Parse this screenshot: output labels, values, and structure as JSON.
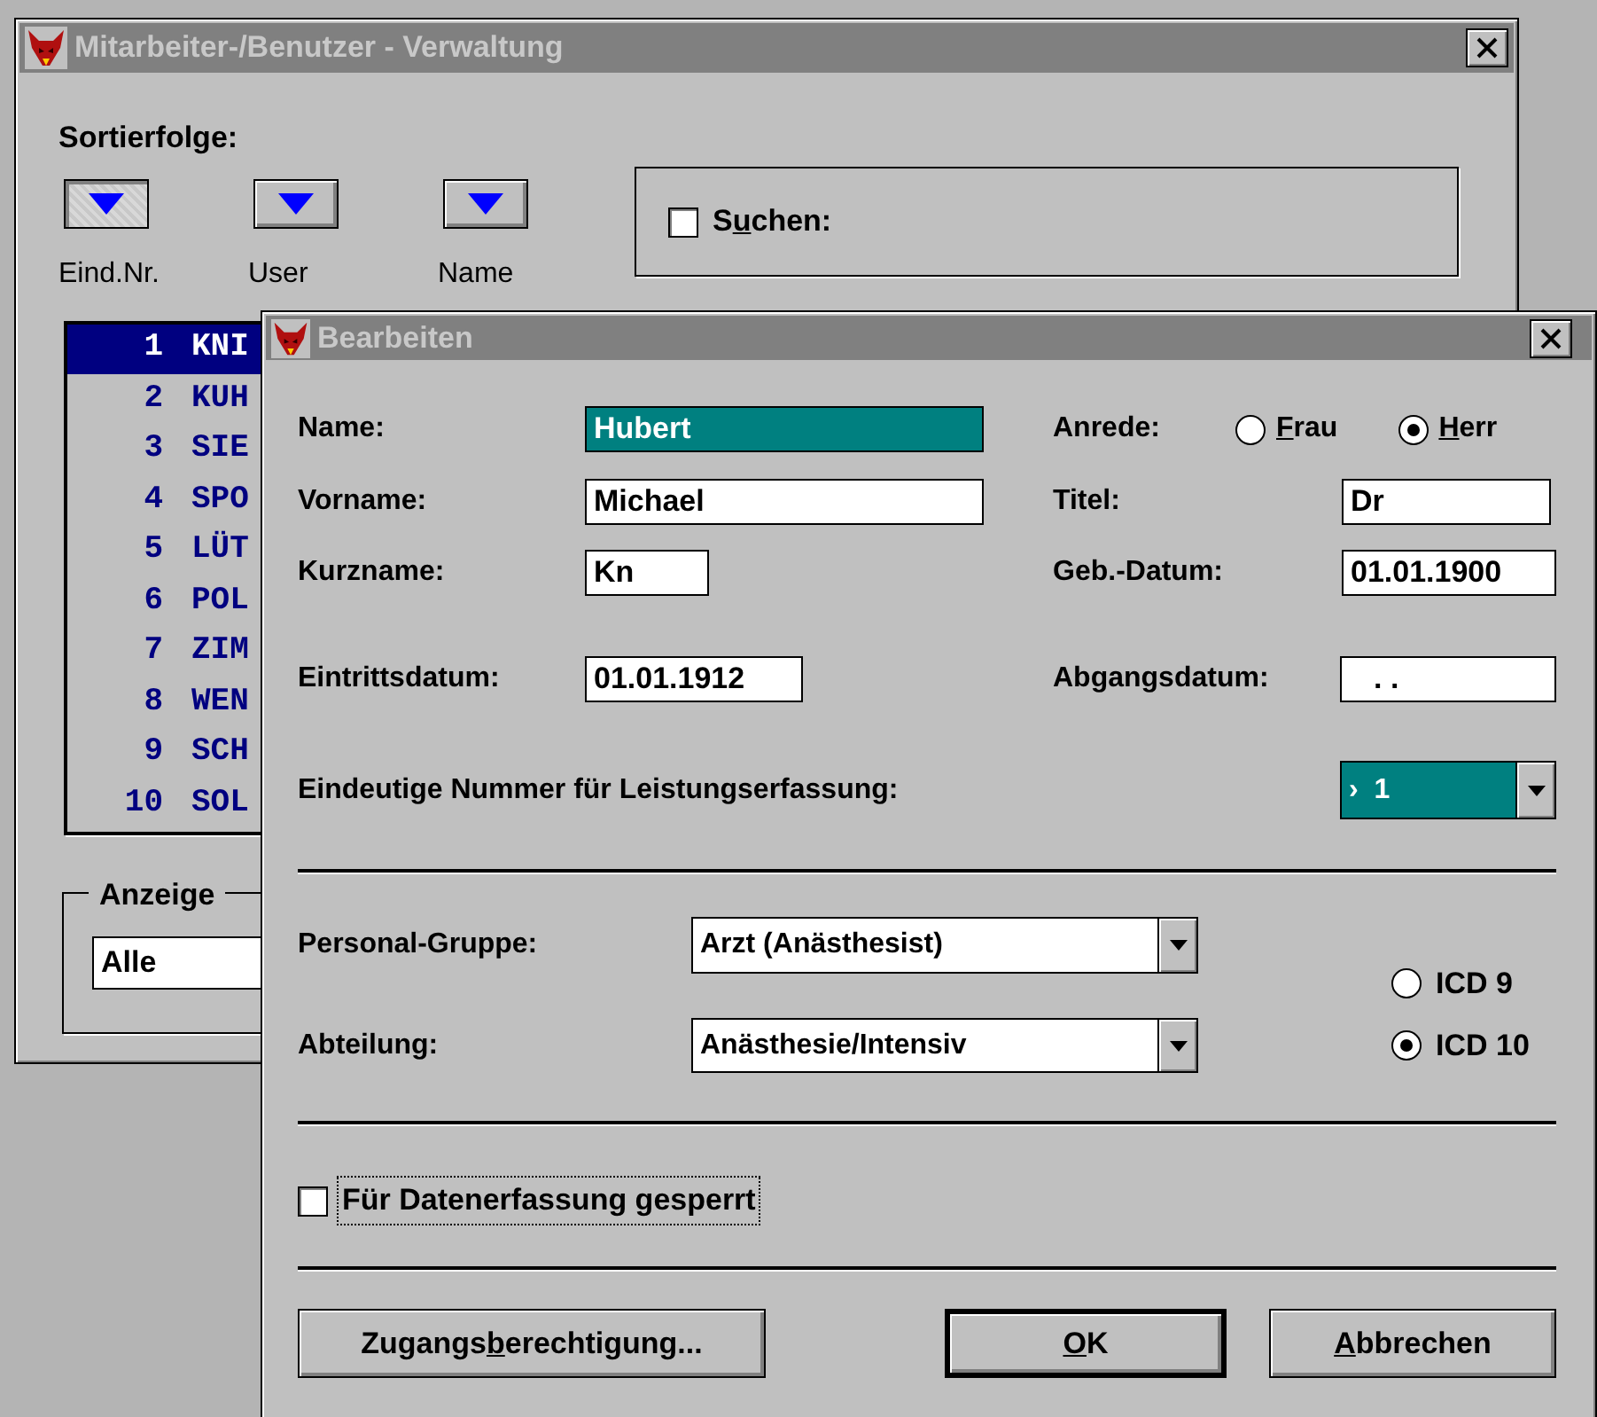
{
  "main_window": {
    "title": "Mitarbeiter-/Benutzer - Verwaltung",
    "sort_label": "Sortierfolge:",
    "sort_buttons": [
      {
        "label": "Eind.Nr.",
        "selected": true
      },
      {
        "label": "User",
        "selected": false
      },
      {
        "label": "Name",
        "selected": false
      }
    ],
    "search": {
      "label": {
        "pre": "S",
        "key": "u",
        "post": "chen:"
      },
      "checked": false
    },
    "list": [
      {
        "number": "1",
        "name": "KNI",
        "selected": true
      },
      {
        "number": "2",
        "name": "KUH",
        "selected": false
      },
      {
        "number": "3",
        "name": "SIE",
        "selected": false
      },
      {
        "number": "4",
        "name": "SPO",
        "selected": false
      },
      {
        "number": "5",
        "name": "LÜT",
        "selected": false
      },
      {
        "number": "6",
        "name": "POL",
        "selected": false
      },
      {
        "number": "7",
        "name": "ZIM",
        "selected": false
      },
      {
        "number": "8",
        "name": "WEN",
        "selected": false
      },
      {
        "number": "9",
        "name": "SCH",
        "selected": false
      },
      {
        "number": "10",
        "name": "SOL",
        "selected": false
      }
    ],
    "display_group": {
      "title": "Anzeige",
      "value": "Alle"
    }
  },
  "dialog": {
    "title": "Bearbeiten",
    "name": {
      "label": "Name:",
      "value": "Hubert",
      "selected": true
    },
    "first_name": {
      "label": "Vorname:",
      "value": "Michael",
      "selected": false
    },
    "short_name": {
      "label": "Kurzname:",
      "value": "Kn",
      "selected": false
    },
    "entry_date": {
      "label": "Eintrittsdatum:",
      "value": "01.01.1912",
      "selected": false
    },
    "salutation": {
      "label": "Anrede:",
      "options": [
        {
          "label": {
            "key": "F",
            "post": "rau"
          },
          "selected": false
        },
        {
          "label": {
            "key": "H",
            "post": "err"
          },
          "selected": true
        }
      ]
    },
    "title_field": {
      "label": "Titel:",
      "value": "Dr",
      "selected": false
    },
    "birth_date": {
      "label": "Geb.-Datum:",
      "value": "01.01.1900",
      "selected": false
    },
    "leave_date": {
      "label": "Abgangsdatum:",
      "value": ". .",
      "selected": false
    },
    "unique_number": {
      "label": "Eindeutige Nummer für Leistungserfassung:",
      "value": "›  1",
      "selected": true
    },
    "staff_group": {
      "label": "Personal-Gruppe:",
      "value": "Arzt (Anästhesist)",
      "selected": false
    },
    "department": {
      "label": "Abteilung:",
      "value": "Anästhesie/Intensiv",
      "selected": false
    },
    "icd": [
      {
        "label": "ICD 9",
        "selected": false
      },
      {
        "label": "ICD 10",
        "selected": true
      }
    ],
    "locked": {
      "label": "Für Datenerfassung gesperrt",
      "checked": false,
      "focused": true
    },
    "buttons": [
      {
        "label": {
          "pre": "Zugangs",
          "key": "b",
          "post": "erechtigung..."
        },
        "default": false
      },
      {
        "label": {
          "key": "O",
          "post": "K"
        },
        "default": true
      },
      {
        "label": {
          "key": "A",
          "post": "bbrechen"
        },
        "default": false
      }
    ]
  }
}
